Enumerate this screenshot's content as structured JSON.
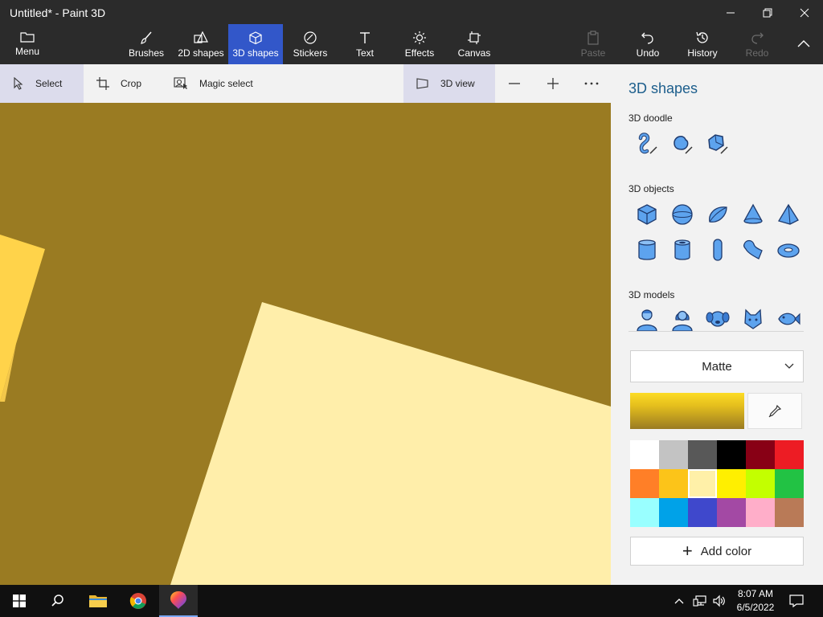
{
  "window": {
    "title": "Untitled* - Paint 3D"
  },
  "ribbon": {
    "menu": "Menu",
    "brushes": "Brushes",
    "shapes2d": "2D shapes",
    "shapes3d": "3D shapes",
    "stickers": "Stickers",
    "text": "Text",
    "effects": "Effects",
    "canvas": "Canvas",
    "paste": "Paste",
    "undo": "Undo",
    "history": "History",
    "redo": "Redo"
  },
  "subbar": {
    "select": "Select",
    "crop": "Crop",
    "magic_select": "Magic select",
    "view3d": "3D view"
  },
  "panel": {
    "title": "3D shapes",
    "doodle_title": "3D doodle",
    "objects_title": "3D objects",
    "models_title": "3D models",
    "material": "Matte",
    "add_color": "Add color",
    "current_color": "#fddc25",
    "palette": [
      "#ffffff",
      "#c3c3c3",
      "#585858",
      "#000000",
      "#880015",
      "#ed1c24",
      "#ff7f27",
      "#fcc419",
      "#fff0a8",
      "#ffef00",
      "#c3ff00",
      "#22c244",
      "#99ffff",
      "#00a2e8",
      "#3f48cc",
      "#a349a4",
      "#ffaec9",
      "#b97a57"
    ],
    "selected_swatch": 8
  },
  "taskbar": {
    "time": "8:07 AM",
    "date": "6/5/2022"
  }
}
